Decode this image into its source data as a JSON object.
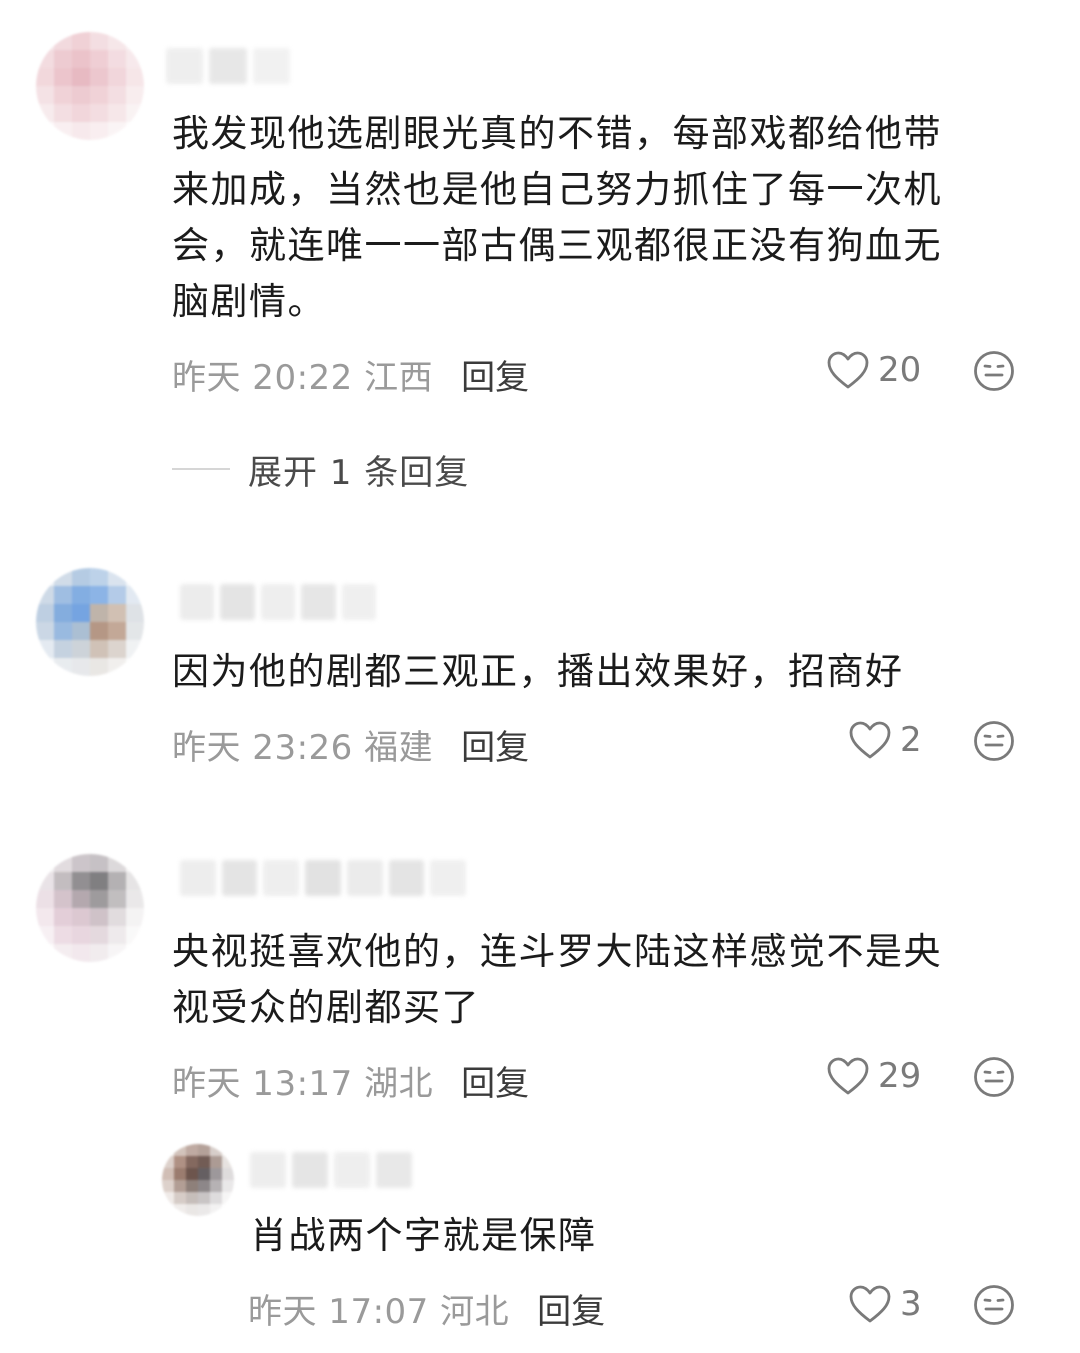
{
  "colors": {
    "text": "#1b1b1b",
    "meta": "#9a9a9a",
    "reply": "#3b3b3b",
    "icon": "#7a7a7a"
  },
  "comments": [
    {
      "text": "我发现他选剧眼光真的不错，每部戏都给他带\n来加成，当然也是他自己努力抓住了每一次机\n会，就连唯一一部古偶三观都很正没有狗血无\n脑剧情。",
      "time_location": "昨天 20:22 江西",
      "reply_label": "回复",
      "likes": "20",
      "like_icon": "heart-outline-icon",
      "dislike_icon": "meh-face-icon",
      "expand_label": "展开 1 条回复"
    },
    {
      "text": "因为他的剧都三观正，播出效果好，招商好",
      "time_location": "昨天 23:26 福建",
      "reply_label": "回复",
      "likes": "2",
      "like_icon": "heart-outline-icon",
      "dislike_icon": "meh-face-icon"
    },
    {
      "text": "央视挺喜欢他的，连斗罗大陆这样感觉不是央\n视受众的剧都买了",
      "time_location": "昨天 13:17 湖北",
      "reply_label": "回复",
      "likes": "29",
      "like_icon": "heart-outline-icon",
      "dislike_icon": "meh-face-icon",
      "replies": [
        {
          "text": "肖战两个字就是保障",
          "time_location": "昨天 17:07 河北",
          "reply_label": "回复",
          "likes": "3",
          "like_icon": "heart-outline-icon",
          "dislike_icon": "meh-face-icon"
        }
      ]
    }
  ]
}
